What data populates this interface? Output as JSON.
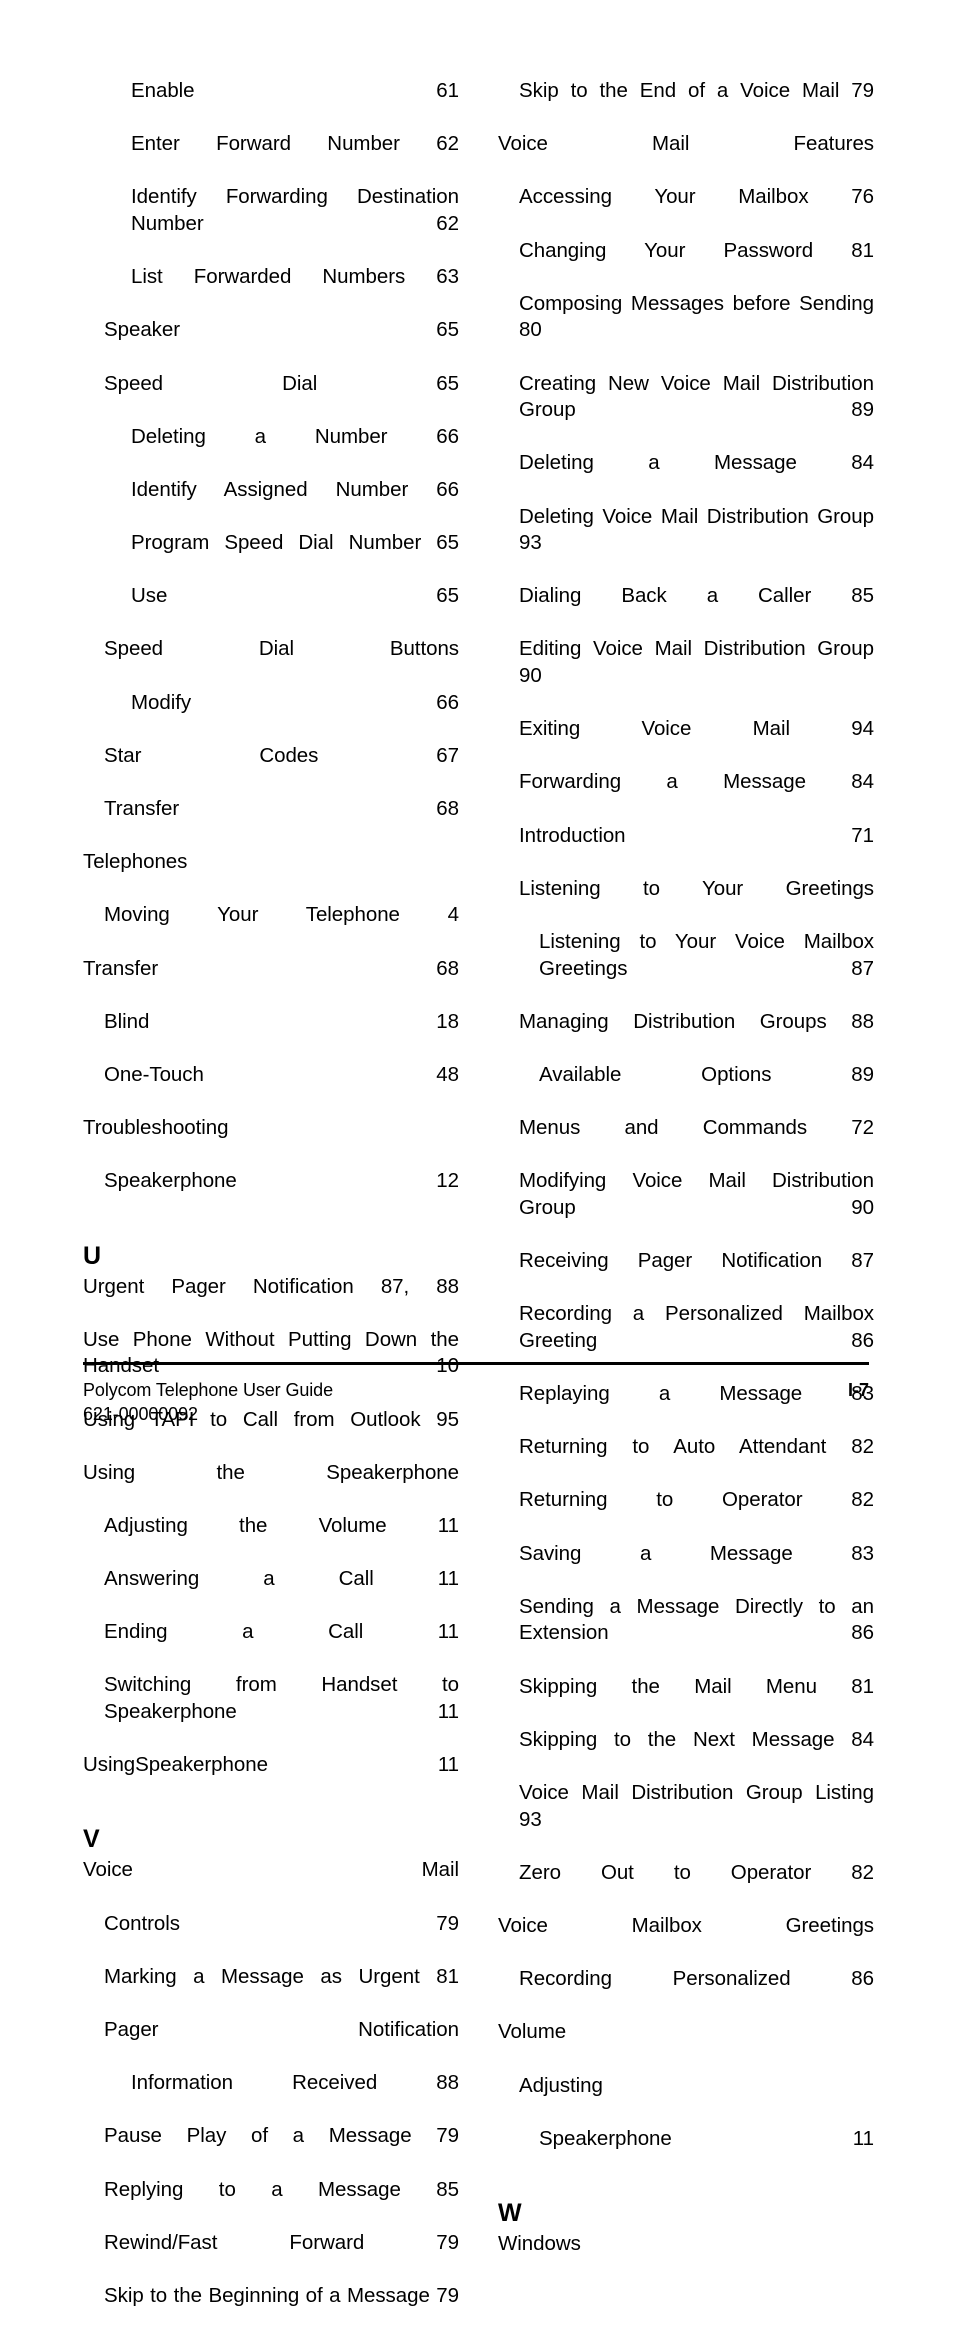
{
  "document": {
    "page_label": "I-7",
    "footer_title": "Polycom Telephone User Guide",
    "footer_part_number": "621-00000092"
  },
  "left_column": {
    "entries": [
      {
        "level": 2,
        "text": "Enable 61"
      },
      {
        "level": 2,
        "text": "Enter Forward Number 62"
      },
      {
        "level": 2,
        "text": "Identify Forwarding Destination Number 62"
      },
      {
        "level": 2,
        "text": "List Forwarded Numbers 63"
      },
      {
        "level": 1,
        "text": "Speaker 65"
      },
      {
        "level": 1,
        "text": "Speed Dial 65"
      },
      {
        "level": 2,
        "text": "Deleting a Number 66"
      },
      {
        "level": 2,
        "text": "Identify Assigned Number 66"
      },
      {
        "level": 2,
        "text": "Program Speed Dial Number 65"
      },
      {
        "level": 2,
        "text": "Use 65"
      },
      {
        "level": 1,
        "text": "Speed Dial Buttons"
      },
      {
        "level": 2,
        "text": "Modify 66"
      },
      {
        "level": 1,
        "text": "Star Codes 67"
      },
      {
        "level": 1,
        "text": "Transfer 68"
      },
      {
        "level": 0,
        "text": "Telephones"
      },
      {
        "level": 1,
        "text": "Moving Your Telephone 4"
      },
      {
        "level": 0,
        "text": "Transfer 68"
      },
      {
        "level": 1,
        "text": "Blind 18"
      },
      {
        "level": 1,
        "text": "One-Touch 48"
      },
      {
        "level": 0,
        "text": "Troubleshooting"
      },
      {
        "level": 1,
        "text": "Speakerphone 12"
      }
    ],
    "letter_u": {
      "heading": "U",
      "entries": [
        {
          "level": 0,
          "text": "Urgent Pager Notification 87, 88"
        },
        {
          "level": 0,
          "text": "Use Phone Without Putting Down the Handset 10"
        },
        {
          "level": 0,
          "text": "Using TAPI to Call from Outlook 95"
        },
        {
          "level": 0,
          "text": "Using the Speakerphone"
        },
        {
          "level": 1,
          "text": "Adjusting the Volume 11"
        },
        {
          "level": 1,
          "text": "Answering a Call 11"
        },
        {
          "level": 1,
          "text": "Ending a Call 11"
        },
        {
          "level": 1,
          "text": "Switching from Handset to Speakerphone 11"
        },
        {
          "level": 0,
          "text": "UsingSpeakerphone 11"
        }
      ]
    },
    "letter_v": {
      "heading": "V",
      "entries": [
        {
          "level": 0,
          "text": "Voice Mail"
        },
        {
          "level": 1,
          "text": "Controls 79"
        },
        {
          "level": 1,
          "text": "Marking a Message as Urgent 81"
        },
        {
          "level": 1,
          "text": "Pager Notification"
        },
        {
          "level": 2,
          "text": "Information Received 88"
        },
        {
          "level": 1,
          "text": "Pause Play of a Message 79"
        },
        {
          "level": 1,
          "text": "Replying to a Message 85"
        },
        {
          "level": 1,
          "text": "Rewind/Fast Forward 79"
        },
        {
          "level": 1,
          "text": "Skip to the Beginning of a Message 79"
        }
      ]
    }
  },
  "right_column": {
    "entries": [
      {
        "level": 1,
        "text": "Skip to the End of a Voice Mail 79"
      },
      {
        "level": 0,
        "text": "Voice Mail Features"
      },
      {
        "level": 1,
        "text": "Accessing Your Mailbox 76"
      },
      {
        "level": 1,
        "text": "Changing Your Password 81"
      },
      {
        "level": 1,
        "text": "Composing Messages before Sending 80"
      },
      {
        "level": 1,
        "text": "Creating New Voice Mail Distribution Group 89"
      },
      {
        "level": 1,
        "text": "Deleting a Message 84"
      },
      {
        "level": 1,
        "text": "Deleting Voice Mail Distribution Group 93"
      },
      {
        "level": 1,
        "text": "Dialing Back a Caller 85"
      },
      {
        "level": 1,
        "text": "Editing Voice Mail Distribution Group 90"
      },
      {
        "level": 1,
        "text": "Exiting Voice Mail 94"
      },
      {
        "level": 1,
        "text": "Forwarding a Message 84"
      },
      {
        "level": 1,
        "text": "Introduction 71"
      },
      {
        "level": 1,
        "text": "Listening to Your Greetings"
      },
      {
        "level": 2,
        "text": "Listening to Your Voice Mailbox Greetings 87"
      },
      {
        "level": 1,
        "text": "Managing Distribution Groups 88"
      },
      {
        "level": 2,
        "text": "Available Options 89"
      },
      {
        "level": 1,
        "text": "Menus and Commands 72"
      },
      {
        "level": 1,
        "text": "Modifying Voice Mail Distribution Group 90"
      },
      {
        "level": 1,
        "text": "Receiving Pager Notification 87"
      },
      {
        "level": 1,
        "text": "Recording a Personalized Mailbox Greeting 86"
      },
      {
        "level": 1,
        "text": "Replaying a Message 83"
      },
      {
        "level": 1,
        "text": "Returning to Auto Attendant 82"
      },
      {
        "level": 1,
        "text": "Returning to Operator 82"
      },
      {
        "level": 1,
        "text": "Saving a Message 83"
      },
      {
        "level": 1,
        "text": "Sending a Message Directly to an Extension 86"
      },
      {
        "level": 1,
        "text": "Skipping the Mail Menu 81"
      },
      {
        "level": 1,
        "text": "Skipping to the Next Message 84"
      },
      {
        "level": 1,
        "text": "Voice Mail Distribution Group Listing 93"
      },
      {
        "level": 1,
        "text": "Zero Out to Operator 82"
      },
      {
        "level": 0,
        "text": "Voice Mailbox Greetings"
      },
      {
        "level": 1,
        "text": "Recording Personalized 86"
      },
      {
        "level": 0,
        "text": "Volume"
      },
      {
        "level": 1,
        "text": "Adjusting"
      },
      {
        "level": 2,
        "text": "Speakerphone 11"
      }
    ],
    "letter_w": {
      "heading": "W",
      "entries": [
        {
          "level": 0,
          "text": "Windows"
        }
      ]
    }
  }
}
